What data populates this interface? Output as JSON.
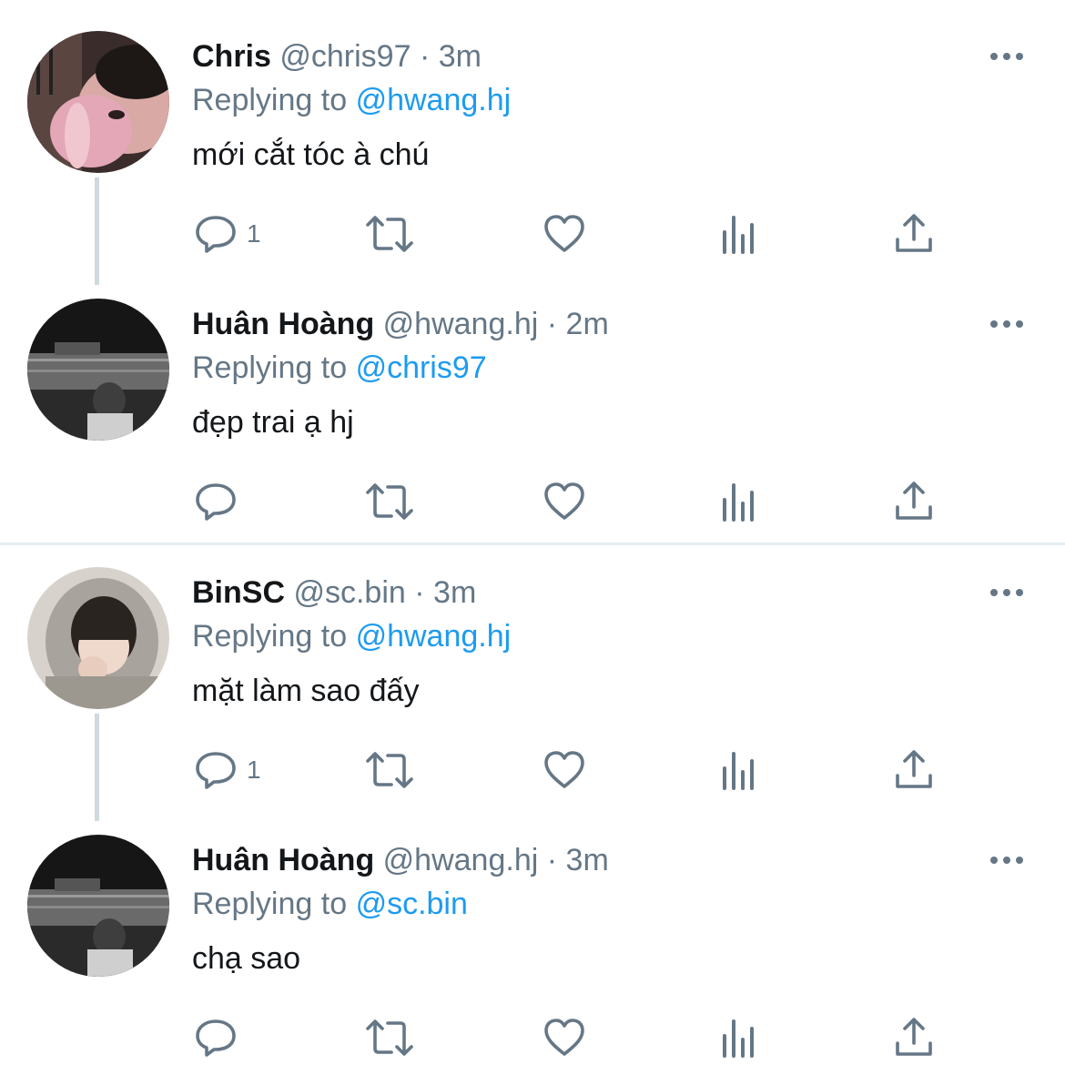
{
  "tweets": [
    {
      "name": "Chris",
      "handle": "@chris97",
      "sep": "·",
      "time": "3m",
      "replying_prefix": "Replying to",
      "replying_to": "@hwang.hj",
      "text": "mới cắt tóc à chú",
      "reply_count": "1"
    },
    {
      "name": "Huân Hoàng",
      "handle": "@hwang.hj",
      "sep": "·",
      "time": "2m",
      "replying_prefix": "Replying to",
      "replying_to": "@chris97",
      "text": "đẹp trai ạ hj",
      "reply_count": ""
    },
    {
      "name": "BinSC",
      "handle": "@sc.bin",
      "sep": "·",
      "time": "3m",
      "replying_prefix": "Replying to",
      "replying_to": "@hwang.hj",
      "text": "mặt làm sao đấy",
      "reply_count": "1"
    },
    {
      "name": "Huân Hoàng",
      "handle": "@hwang.hj",
      "sep": "·",
      "time": "3m",
      "replying_prefix": "Replying to",
      "replying_to": "@sc.bin",
      "text": "chạ sao",
      "reply_count": ""
    }
  ],
  "icons": {
    "reply": "reply-icon",
    "retweet": "retweet-icon",
    "like": "heart-icon",
    "analytics": "analytics-icon",
    "share": "share-icon",
    "more": "more-icon"
  },
  "colors": {
    "text": "#14171a",
    "secondary": "#657786",
    "mention": "#1d9bf0",
    "icon": "#657786",
    "thread_line": "#cfd9de"
  }
}
